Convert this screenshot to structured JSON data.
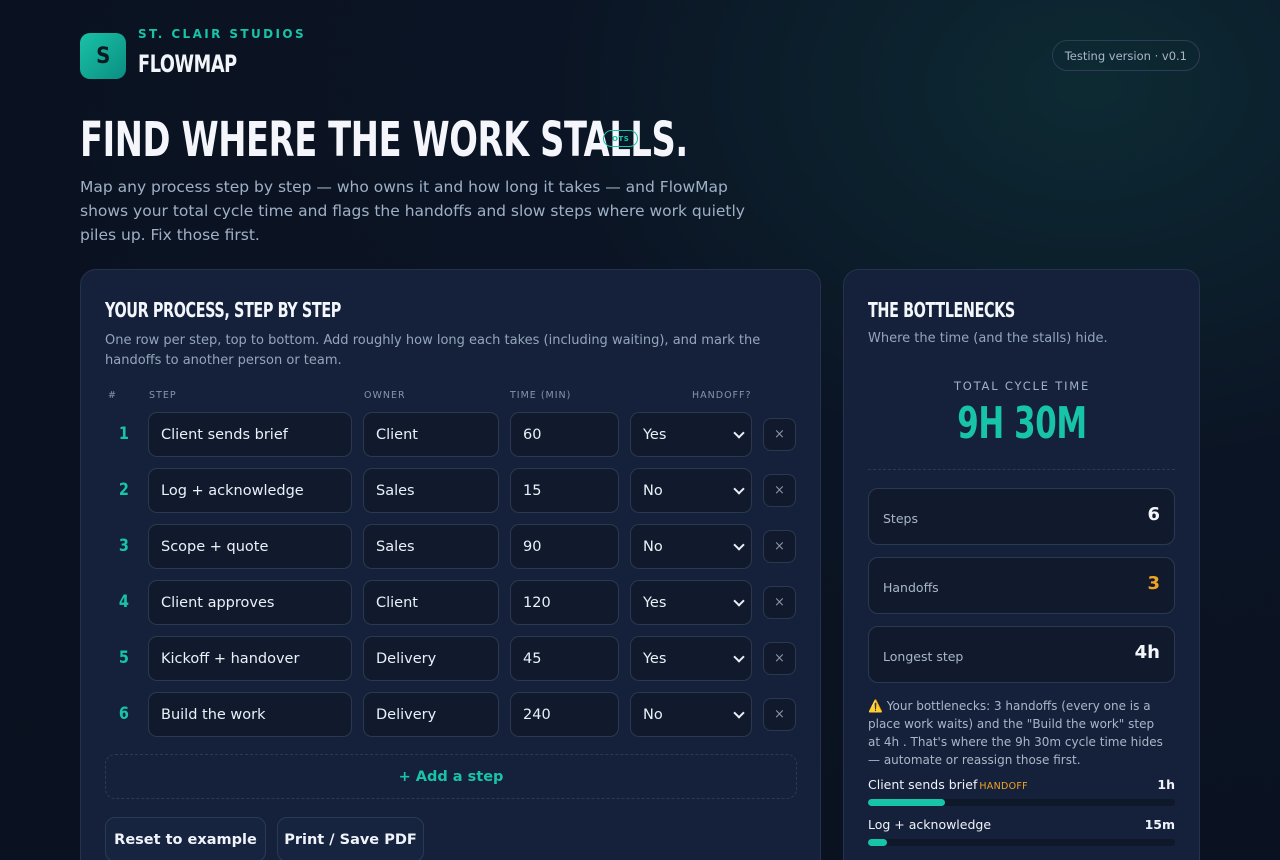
{
  "brand": {
    "logo_letter": "S",
    "kicker": "ST. CLAIR STUDIOS",
    "name": "FLOWMAP"
  },
  "version": "Testing version · v0.1",
  "hero": {
    "title": "FIND WHERE THE WORK STALLS.",
    "tag": "OTS",
    "subtitle": "Map any process step by step — who owns it and how long it takes — and FlowMap shows your total cycle time and flags the handoffs and slow steps where work quietly piles up. Fix those first."
  },
  "process": {
    "title": "YOUR PROCESS, STEP BY STEP",
    "description": "One row per step, top to bottom. Add roughly how long each takes (including waiting), and mark the handoffs to another person or team.",
    "columns": {
      "num": "#",
      "step": "STEP",
      "owner": "OWNER",
      "time": "TIME (MIN)",
      "handoff": "HANDOFF?"
    },
    "rows": [
      {
        "num": "1",
        "step": "Client sends brief",
        "owner": "Client",
        "time": "60",
        "handoff": "Yes",
        "delete": "×"
      },
      {
        "num": "2",
        "step": "Log + acknowledge",
        "owner": "Sales",
        "time": "15",
        "handoff": "No",
        "delete": "×"
      },
      {
        "num": "3",
        "step": "Scope + quote",
        "owner": "Sales",
        "time": "90",
        "handoff": "No",
        "delete": "×"
      },
      {
        "num": "4",
        "step": "Client approves",
        "owner": "Client",
        "time": "120",
        "handoff": "Yes",
        "delete": "×"
      },
      {
        "num": "5",
        "step": "Kickoff + handover",
        "owner": "Delivery",
        "time": "45",
        "handoff": "Yes",
        "delete": "×"
      },
      {
        "num": "6",
        "step": "Build the work",
        "owner": "Delivery",
        "time": "240",
        "handoff": "No",
        "delete": "×"
      }
    ],
    "add_step": "+ Add a step",
    "reset_label": "Reset to example",
    "print_label": "Print / Save PDF"
  },
  "bottlenecks": {
    "title": "THE BOTTLENECKS",
    "description": "Where the time (and the stalls) hide.",
    "cycle_label": "TOTAL CYCLE TIME",
    "cycle_value": "9H 30M",
    "stats": [
      {
        "label": "Steps",
        "value": "6",
        "warn": false
      },
      {
        "label": "Handoffs",
        "value": "3",
        "warn": true
      },
      {
        "label": "Longest step",
        "value": "4h",
        "warn": false
      }
    ],
    "warning_icon": "⚠️",
    "summary": "Your bottlenecks: 3 handoffs (every one is a place work waits) and the \"Build the work\" step at 4h . That's where the 9h 30m cycle time hides — automate or reassign those first.",
    "bars": [
      {
        "name": "Client sends brief",
        "tag": "HANDOFF",
        "value": "1h",
        "fraction": 0.25
      },
      {
        "name": "Log + acknowledge",
        "tag": "",
        "value": "15m",
        "fraction": 0.0625
      }
    ],
    "accent_color": "#18c4a8",
    "warn_color": "#f0a424"
  }
}
